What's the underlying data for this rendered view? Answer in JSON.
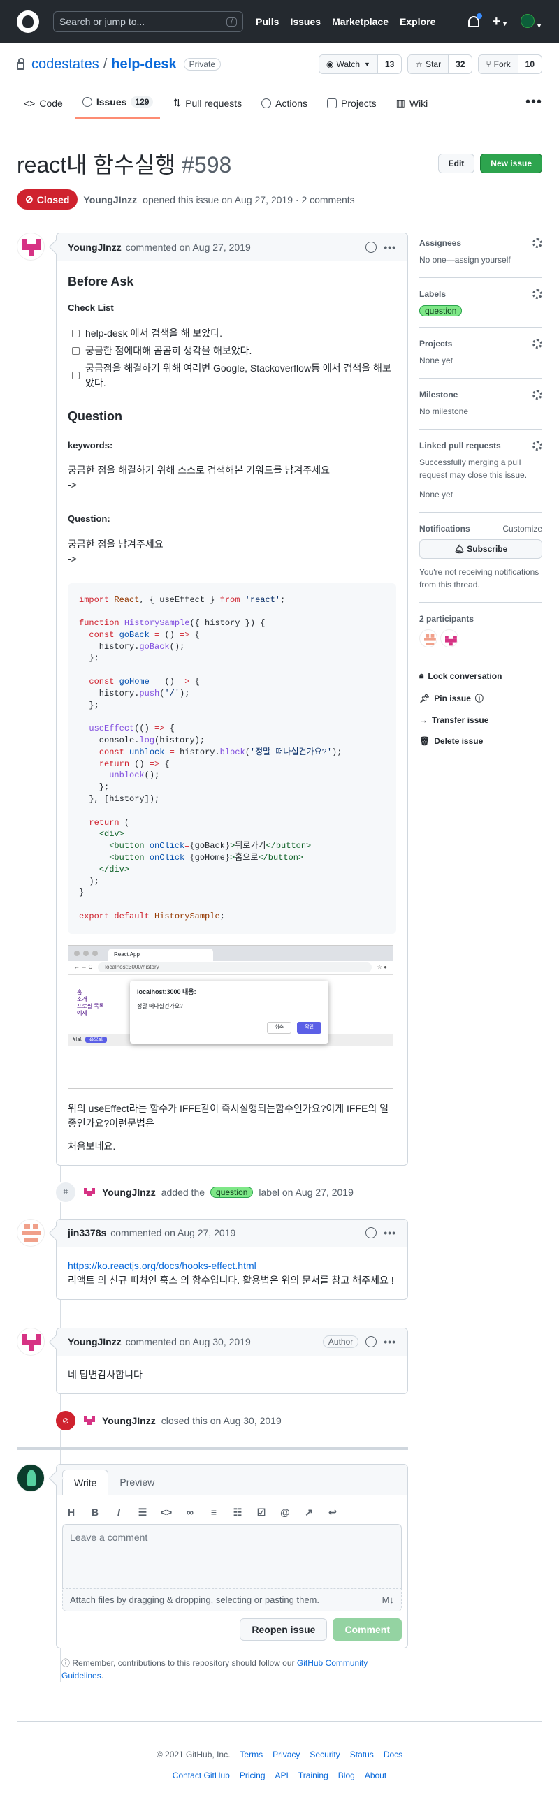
{
  "header": {
    "search_placeholder": "Search or jump to...",
    "slash_key": "/",
    "nav": [
      "Pulls",
      "Issues",
      "Marketplace",
      "Explore"
    ]
  },
  "repo": {
    "owner": "codestates",
    "separator": "/",
    "name": "help-desk",
    "visibility": "Private",
    "watch_label": "Watch",
    "watch_count": "13",
    "star_label": "Star",
    "star_count": "32",
    "fork_label": "Fork",
    "fork_count": "10",
    "tabs": [
      {
        "label": "Code"
      },
      {
        "label": "Issues",
        "count": "129"
      },
      {
        "label": "Pull requests"
      },
      {
        "label": "Actions"
      },
      {
        "label": "Projects"
      },
      {
        "label": "Wiki"
      }
    ],
    "more": "•••"
  },
  "issue": {
    "title": "react내 함수실행",
    "number": "#598",
    "edit_label": "Edit",
    "new_issue_label": "New issue",
    "state": "Closed",
    "author": "YoungJInzz",
    "opened_text": "opened this issue on Aug 27, 2019 · 2 comments"
  },
  "first_comment": {
    "author": "YoungJInzz",
    "meta": "commented on Aug 27, 2019",
    "h_before": "Before Ask",
    "h_checklist": "Check List",
    "tasks": [
      "help-desk 에서 검색을 해 보았다.",
      "궁금한 점에대해 곰곰히 생각을 해보았다.",
      "궁금점을 해결하기 위해 여러번 Google, Stackoverflow등 에서 검색을 해보았다."
    ],
    "h_question": "Question",
    "h_keywords": "keywords:",
    "keywords_text": "궁금한 점을 해결하기 위해 스스로 검색해본 키워드를 남겨주세요",
    "keywords_arrow": "->",
    "h_q2": "Question:",
    "q2_text": "궁금한 점을 남겨주세요",
    "q2_arrow": "->",
    "code_lines": [
      [
        [
          "k",
          "import "
        ],
        [
          "v",
          "React"
        ],
        [
          "",
          ", { useEffect } "
        ],
        [
          "k",
          "from "
        ],
        [
          "s",
          "'react'"
        ],
        [
          "",
          ";"
        ]
      ],
      [],
      [
        [
          "k",
          "function "
        ],
        [
          "f",
          "HistorySample"
        ],
        [
          "",
          "({ history }) {"
        ]
      ],
      [
        [
          "",
          "  "
        ],
        [
          "k",
          "const "
        ],
        [
          "b",
          "goBack"
        ],
        [
          "k",
          " = "
        ],
        [
          "",
          "() "
        ],
        [
          "k",
          "=>"
        ],
        [
          "",
          " {"
        ]
      ],
      [
        [
          "",
          "    history."
        ],
        [
          "f",
          "goBack"
        ],
        [
          "",
          "();"
        ]
      ],
      [
        [
          "",
          "  };"
        ]
      ],
      [],
      [
        [
          "",
          "  "
        ],
        [
          "k",
          "const "
        ],
        [
          "b",
          "goHome"
        ],
        [
          "k",
          " = "
        ],
        [
          "",
          "() "
        ],
        [
          "k",
          "=>"
        ],
        [
          "",
          " {"
        ]
      ],
      [
        [
          "",
          "    history."
        ],
        [
          "f",
          "push"
        ],
        [
          "",
          "("
        ],
        [
          "s",
          "'/'"
        ],
        [
          "",
          ");"
        ]
      ],
      [
        [
          "",
          "  };"
        ]
      ],
      [],
      [
        [
          "",
          "  "
        ],
        [
          "f",
          "useEffect"
        ],
        [
          "",
          "(() "
        ],
        [
          "k",
          "=>"
        ],
        [
          "",
          " {"
        ]
      ],
      [
        [
          "",
          "    console."
        ],
        [
          "f",
          "log"
        ],
        [
          "",
          "(history);"
        ]
      ],
      [
        [
          "",
          "    "
        ],
        [
          "k",
          "const "
        ],
        [
          "b",
          "unblock"
        ],
        [
          "k",
          " = "
        ],
        [
          "",
          "history."
        ],
        [
          "f",
          "block"
        ],
        [
          "",
          "("
        ],
        [
          "s",
          "'정말 떠나실건가요?'"
        ],
        [
          "",
          ");"
        ]
      ],
      [
        [
          "",
          "    "
        ],
        [
          "k",
          "return "
        ],
        [
          "",
          "() "
        ],
        [
          "k",
          "=>"
        ],
        [
          "",
          " {"
        ]
      ],
      [
        [
          "",
          "      "
        ],
        [
          "f",
          "unblock"
        ],
        [
          "",
          "();"
        ]
      ],
      [
        [
          "",
          "    };"
        ]
      ],
      [
        [
          "",
          "  }, [history]);"
        ]
      ],
      [],
      [
        [
          "",
          "  "
        ],
        [
          "k",
          "return "
        ],
        [
          "",
          "("
        ]
      ],
      [
        [
          "",
          "    "
        ],
        [
          "g",
          "<div>"
        ]
      ],
      [
        [
          "",
          "      "
        ],
        [
          "g",
          "<button "
        ],
        [
          "b",
          "onClick"
        ],
        [
          "k",
          "="
        ],
        [
          "",
          "{goBack}"
        ],
        [
          "g",
          ">"
        ],
        [
          "",
          "뒤로가기"
        ],
        [
          "g",
          "</button>"
        ]
      ],
      [
        [
          "",
          "      "
        ],
        [
          "g",
          "<button "
        ],
        [
          "b",
          "onClick"
        ],
        [
          "k",
          "="
        ],
        [
          "",
          "{goHome}"
        ],
        [
          "g",
          ">"
        ],
        [
          "",
          "홈으로"
        ],
        [
          "g",
          "</button>"
        ]
      ],
      [
        [
          "",
          "    "
        ],
        [
          "g",
          "</div>"
        ]
      ],
      [
        [
          "",
          "  );"
        ]
      ],
      [
        [
          "",
          "}"
        ]
      ],
      [],
      [
        [
          "k",
          "export default "
        ],
        [
          "v",
          "HistorySample"
        ],
        [
          "",
          ";"
        ]
      ]
    ],
    "screenshot": {
      "tab_title": "React App",
      "url": "localhost:3000/history",
      "links": [
        "홈",
        "소개",
        "프로필 목록",
        "예제"
      ],
      "dialog_title": "localhost:3000 내용:",
      "dialog_text": "정말 떠나실건가요?",
      "cancel": "취소",
      "ok": "확인",
      "bar_left": "뒤로",
      "bar_btn": "홈으로"
    },
    "para1": "위의 useEffect라는 함수가 IFFE같이 즉시실행되는함수인가요?이게 IFFE의 일종인가요?이런문법은",
    "para2": "처음보네요."
  },
  "event_label": {
    "actor": "YoungJInzz",
    "pre": "added the",
    "label": "question",
    "post": "label on Aug 27, 2019"
  },
  "second_comment": {
    "author": "jin3378s",
    "meta": "commented on Aug 27, 2019",
    "link": "https://ko.reactjs.org/docs/hooks-effect.html",
    "text": "리액트 의 신규 피처인 훅스 의 함수입니다. 활용법은 위의 문서를 참고 해주세요 !"
  },
  "third_comment": {
    "author": "YoungJInzz",
    "meta": "commented on Aug 30, 2019",
    "badge": "Author",
    "text": "네 답변감사합니다"
  },
  "event_closed": {
    "actor": "YoungJInzz",
    "text": "closed this on Aug 30, 2019"
  },
  "new_comment": {
    "tab_write": "Write",
    "tab_preview": "Preview",
    "placeholder": "Leave a comment",
    "attach": "Attach files by dragging & dropping, selecting or pasting them.",
    "md": "M↓",
    "reopen": "Reopen issue",
    "submit": "Comment",
    "tip_pre": "Remember, contributions to this repository should follow our ",
    "tip_link": "GitHub Community Guidelines",
    "tip_post": "."
  },
  "sidebar": {
    "assignees": "Assignees",
    "assignees_value": "No one—assign yourself",
    "labels": "Labels",
    "label_value": "question",
    "projects": "Projects",
    "projects_value": "None yet",
    "milestone": "Milestone",
    "milestone_value": "No milestone",
    "linked": "Linked pull requests",
    "linked_text": "Successfully merging a pull request may close this issue.",
    "linked_value": "None yet",
    "notifications": "Notifications",
    "customize": "Customize",
    "subscribe": "Subscribe",
    "notif_text": "You're not receiving notifications from this thread.",
    "participants": "2 participants",
    "lock": "Lock conversation",
    "pin": "Pin issue",
    "transfer": "Transfer issue",
    "delete": "Delete issue"
  },
  "footer": {
    "copyright": "© 2021 GitHub, Inc.",
    "row1": [
      "Terms",
      "Privacy",
      "Security",
      "Status",
      "Docs"
    ],
    "row2": [
      "Contact GitHub",
      "Pricing",
      "API",
      "Training",
      "Blog",
      "About"
    ]
  },
  "colors": {
    "closed": "#cf222e",
    "green": "#2da44e",
    "link": "#0969da",
    "label": "#7ee787"
  }
}
